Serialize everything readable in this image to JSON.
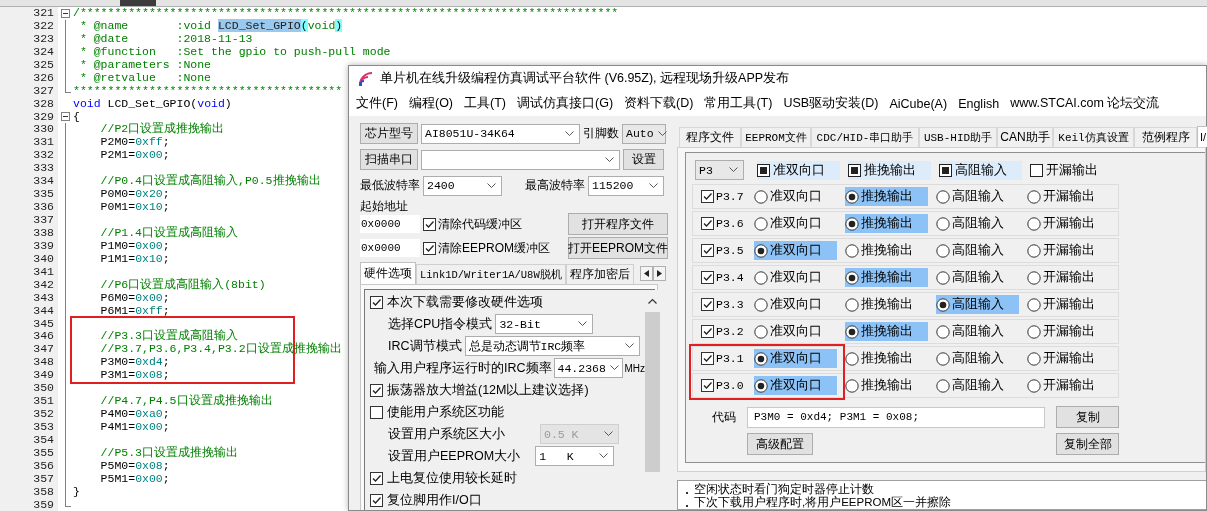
{
  "editor": {
    "lines": [
      {
        "number": "321",
        "fold_toggle": true,
        "tokens": [
          {
            "kind": "comment",
            "text": "/******************************************************************************"
          }
        ]
      },
      {
        "number": "322",
        "fold_line": true,
        "tokens": [
          {
            "kind": "comment",
            "text": " * @name       :void "
          },
          {
            "kind": "selection",
            "text": "LCD_Set_GPIO"
          },
          {
            "kind": "brace",
            "text": "("
          },
          {
            "kind": "comment",
            "text": "void"
          },
          {
            "kind": "brace",
            "text": ")"
          }
        ]
      },
      {
        "number": "323",
        "fold_line": true,
        "tokens": [
          {
            "kind": "comment",
            "text": " * @date       :2018-11-13"
          }
        ]
      },
      {
        "number": "324",
        "fold_line": true,
        "tokens": [
          {
            "kind": "comment",
            "text": " * @function   :Set the gpio to push-pull mode"
          }
        ]
      },
      {
        "number": "325",
        "fold_line": true,
        "tokens": [
          {
            "kind": "comment",
            "text": " * @parameters :None"
          }
        ]
      },
      {
        "number": "326",
        "fold_line": true,
        "tokens": [
          {
            "kind": "comment",
            "text": " * @retvalue   :None"
          }
        ]
      },
      {
        "number": "327",
        "fold_end": true,
        "tokens": [
          {
            "kind": "comment",
            "text": "***************************************"
          }
        ]
      },
      {
        "number": "328",
        "tokens": [
          {
            "kind": "keyword",
            "text": "void"
          },
          {
            "kind": "plain",
            "text": " LCD_Set_GPIO("
          },
          {
            "kind": "keyword",
            "text": "void"
          },
          {
            "kind": "plain",
            "text": ")"
          }
        ]
      },
      {
        "number": "329",
        "fold_toggle": true,
        "tokens": [
          {
            "kind": "plain",
            "text": "{"
          }
        ]
      },
      {
        "number": "330",
        "fold_line": true,
        "tokens": [
          {
            "kind": "comment",
            "text": "    //P2口设置成推挽输出"
          }
        ]
      },
      {
        "number": "331",
        "fold_line": true,
        "tokens": [
          {
            "kind": "plain",
            "text": "    P2M0="
          },
          {
            "kind": "number",
            "text": "0xff"
          },
          {
            "kind": "plain",
            "text": ";"
          }
        ]
      },
      {
        "number": "332",
        "fold_line": true,
        "tokens": [
          {
            "kind": "plain",
            "text": "    P2M1="
          },
          {
            "kind": "number",
            "text": "0x00"
          },
          {
            "kind": "plain",
            "text": ";"
          }
        ]
      },
      {
        "number": "333",
        "fold_line": true
      },
      {
        "number": "334",
        "fold_line": true,
        "tokens": [
          {
            "kind": "comment",
            "text": "    //P0.4口设置成高阻输入,P0.5推挽输出"
          }
        ]
      },
      {
        "number": "335",
        "fold_line": true,
        "tokens": [
          {
            "kind": "plain",
            "text": "    P0M0="
          },
          {
            "kind": "number",
            "text": "0x20"
          },
          {
            "kind": "plain",
            "text": ";"
          }
        ]
      },
      {
        "number": "336",
        "fold_line": true,
        "tokens": [
          {
            "kind": "plain",
            "text": "    P0M1="
          },
          {
            "kind": "number",
            "text": "0x10"
          },
          {
            "kind": "plain",
            "text": ";"
          }
        ]
      },
      {
        "number": "337",
        "fold_line": true
      },
      {
        "number": "338",
        "fold_line": true,
        "tokens": [
          {
            "kind": "comment",
            "text": "    //P1.4口设置成高阻输入"
          }
        ]
      },
      {
        "number": "339",
        "fold_line": true,
        "tokens": [
          {
            "kind": "plain",
            "text": "    P1M0="
          },
          {
            "kind": "number",
            "text": "0x00"
          },
          {
            "kind": "plain",
            "text": ";"
          }
        ]
      },
      {
        "number": "340",
        "fold_line": true,
        "tokens": [
          {
            "kind": "plain",
            "text": "    P1M1="
          },
          {
            "kind": "number",
            "text": "0x10"
          },
          {
            "kind": "plain",
            "text": ";"
          }
        ]
      },
      {
        "number": "341",
        "fold_line": true
      },
      {
        "number": "342",
        "fold_line": true,
        "tokens": [
          {
            "kind": "comment",
            "text": "    //P6口设置成高阻输入(8bit)"
          }
        ]
      },
      {
        "number": "343",
        "fold_line": true,
        "tokens": [
          {
            "kind": "plain",
            "text": "    P6M0="
          },
          {
            "kind": "number",
            "text": "0x00"
          },
          {
            "kind": "plain",
            "text": ";"
          }
        ]
      },
      {
        "number": "344",
        "fold_line": true,
        "tokens": [
          {
            "kind": "plain",
            "text": "    P6M1="
          },
          {
            "kind": "number",
            "text": "0xff"
          },
          {
            "kind": "plain",
            "text": ";"
          }
        ]
      },
      {
        "number": "345",
        "fold_line": true,
        "marked": true
      },
      {
        "number": "346",
        "fold_line": true,
        "marked": true,
        "tokens": [
          {
            "kind": "comment",
            "text": "    //P3.3口设置成高阻输入"
          }
        ]
      },
      {
        "number": "347",
        "fold_line": true,
        "marked": true,
        "tokens": [
          {
            "kind": "comment",
            "text": "    //P3.7,P3.6,P3.4,P3.2口设置成推挽输出"
          }
        ]
      },
      {
        "number": "348",
        "fold_line": true,
        "marked": true,
        "tokens": [
          {
            "kind": "plain",
            "text": "    P3M0="
          },
          {
            "kind": "number",
            "text": "0xd4"
          },
          {
            "kind": "plain",
            "text": ";"
          }
        ]
      },
      {
        "number": "349",
        "fold_line": true,
        "marked": true,
        "tokens": [
          {
            "kind": "plain",
            "text": "    P3M1="
          },
          {
            "kind": "number",
            "text": "0x08"
          },
          {
            "kind": "plain",
            "text": ";"
          }
        ]
      },
      {
        "number": "350",
        "fold_line": true
      },
      {
        "number": "351",
        "fold_line": true,
        "tokens": [
          {
            "kind": "comment",
            "text": "    //P4.7,P4.5口设置成推挽输出"
          }
        ]
      },
      {
        "number": "352",
        "fold_line": true,
        "tokens": [
          {
            "kind": "plain",
            "text": "    P4M0="
          },
          {
            "kind": "number",
            "text": "0xa0"
          },
          {
            "kind": "plain",
            "text": ";"
          }
        ]
      },
      {
        "number": "353",
        "fold_line": true,
        "tokens": [
          {
            "kind": "plain",
            "text": "    P4M1="
          },
          {
            "kind": "number",
            "text": "0x00"
          },
          {
            "kind": "plain",
            "text": ";"
          }
        ]
      },
      {
        "number": "354",
        "fold_line": true
      },
      {
        "number": "355",
        "fold_line": true,
        "tokens": [
          {
            "kind": "comment",
            "text": "    //P5.3口设置成推挽输出"
          }
        ]
      },
      {
        "number": "356",
        "fold_line": true,
        "tokens": [
          {
            "kind": "plain",
            "text": "    P5M0="
          },
          {
            "kind": "number",
            "text": "0x08"
          },
          {
            "kind": "plain",
            "text": ";"
          }
        ]
      },
      {
        "number": "357",
        "fold_line": true,
        "tokens": [
          {
            "kind": "plain",
            "text": "    P5M1="
          },
          {
            "kind": "number",
            "text": "0x00"
          },
          {
            "kind": "plain",
            "text": ";"
          }
        ]
      },
      {
        "number": "358",
        "fold_line": true,
        "tokens": [
          {
            "kind": "plain",
            "text": "}"
          }
        ]
      },
      {
        "number": "359",
        "fold_end": true
      }
    ]
  },
  "window": {
    "title": "单片机在线升级编程仿真调试平台软件 (V6.95Z), 远程现场升级APP发布",
    "menu": [
      "文件(F)",
      "编程(O)",
      "工具(T)",
      "调试仿真接口(G)",
      "资料下载(D)",
      "常用工具(T)",
      "USB驱动安装(D)",
      "AiCube(A)",
      "English",
      "www.STCAI.com 论坛交流"
    ],
    "left": {
      "chip": {
        "button": "芯片型号",
        "value": "AI8051U-34K64",
        "pins_label": "引脚数",
        "pins_value": "Auto"
      },
      "port": {
        "button": "扫描串口",
        "settings_button": "设置"
      },
      "baud": {
        "min_label": "最低波特率",
        "min_value": "2400",
        "max_label": "最高波特率",
        "max_value": "115200"
      },
      "start_address_label": "起始地址",
      "buffers": [
        {
          "address": "0x0000",
          "label": "清除代码缓冲区",
          "checked": true,
          "button": "打开程序文件"
        },
        {
          "address": "0x0000",
          "label": "清除EEPROM缓冲区",
          "checked": true,
          "button": "打开EEPROM文件"
        }
      ],
      "tabs": [
        {
          "label": "硬件选项",
          "selected": true
        },
        {
          "label": "Link1D/Writer1A/U8W脱机",
          "selected": false
        },
        {
          "label": "程序加密后",
          "selected": false
        }
      ],
      "options": [
        {
          "kind": "check",
          "label": "本次下载需要修改硬件选项",
          "checked": true
        },
        {
          "kind": "select",
          "label": "选择CPU指令模式",
          "value": "32-Bit",
          "disabled": false
        },
        {
          "kind": "select",
          "label": "IRC调节模式",
          "value": "总是动态调节IRC频率",
          "disabled": false
        },
        {
          "kind": "combo",
          "label": "输入用户程序运行时的IRC频率",
          "value": "44.2368",
          "unit": "MHz"
        },
        {
          "kind": "check",
          "label": "振荡器放大增益(12M以上建议选择)",
          "checked": true
        },
        {
          "kind": "check",
          "label": "使能用户系统区功能",
          "checked": false
        },
        {
          "kind": "select",
          "label": "设置用户系统区大小",
          "value": "0.5 K",
          "disabled": true
        },
        {
          "kind": "select",
          "label": "设置用户EEPROM大小",
          "value": "1   K",
          "disabled": false
        },
        {
          "kind": "check",
          "label": "上电复位使用较长延时",
          "checked": true
        },
        {
          "kind": "check",
          "label": "复位脚用作I/O口",
          "checked": true
        }
      ]
    },
    "right": {
      "tabs": [
        {
          "label": "程序文件",
          "selected": false
        },
        {
          "label": "EEPROM文件",
          "selected": false
        },
        {
          "label": "CDC/HID-串口助手",
          "selected": false
        },
        {
          "label": "USB-HID助手",
          "selected": false
        },
        {
          "label": "CAN助手",
          "selected": false
        },
        {
          "label": "Keil仿真设置",
          "selected": false
        },
        {
          "label": "范例程序",
          "selected": false
        },
        {
          "label": "I/",
          "selected": true
        }
      ],
      "port_select": "P3",
      "modes": [
        {
          "label": "准双向口",
          "mixed": true
        },
        {
          "label": "推挽输出",
          "mixed": true
        },
        {
          "label": "高阻输入",
          "mixed": true
        },
        {
          "label": "开漏输出",
          "mixed": false
        }
      ],
      "pins": [
        {
          "name": "P3.7",
          "checked": true,
          "marked": false,
          "options": [
            {
              "label": "准双向口",
              "selected": false
            },
            {
              "label": "推挽输出",
              "selected": true
            },
            {
              "label": "高阻输入",
              "selected": false
            },
            {
              "label": "开漏输出",
              "selected": false
            }
          ]
        },
        {
          "name": "P3.6",
          "checked": true,
          "marked": false,
          "options": [
            {
              "label": "准双向口",
              "selected": false
            },
            {
              "label": "推挽输出",
              "selected": true
            },
            {
              "label": "高阻输入",
              "selected": false
            },
            {
              "label": "开漏输出",
              "selected": false
            }
          ]
        },
        {
          "name": "P3.5",
          "checked": true,
          "marked": false,
          "options": [
            {
              "label": "准双向口",
              "selected": true
            },
            {
              "label": "推挽输出",
              "selected": false
            },
            {
              "label": "高阻输入",
              "selected": false
            },
            {
              "label": "开漏输出",
              "selected": false
            }
          ]
        },
        {
          "name": "P3.4",
          "checked": true,
          "marked": false,
          "options": [
            {
              "label": "准双向口",
              "selected": false
            },
            {
              "label": "推挽输出",
              "selected": true
            },
            {
              "label": "高阻输入",
              "selected": false
            },
            {
              "label": "开漏输出",
              "selected": false
            }
          ]
        },
        {
          "name": "P3.3",
          "checked": true,
          "marked": false,
          "options": [
            {
              "label": "准双向口",
              "selected": false
            },
            {
              "label": "推挽输出",
              "selected": false
            },
            {
              "label": "高阻输入",
              "selected": true
            },
            {
              "label": "开漏输出",
              "selected": false
            }
          ]
        },
        {
          "name": "P3.2",
          "checked": true,
          "marked": false,
          "options": [
            {
              "label": "准双向口",
              "selected": false
            },
            {
              "label": "推挽输出",
              "selected": true
            },
            {
              "label": "高阻输入",
              "selected": false
            },
            {
              "label": "开漏输出",
              "selected": false
            }
          ]
        },
        {
          "name": "P3.1",
          "checked": true,
          "marked": true,
          "options": [
            {
              "label": "准双向口",
              "selected": true
            },
            {
              "label": "推挽输出",
              "selected": false
            },
            {
              "label": "高阻输入",
              "selected": false
            },
            {
              "label": "开漏输出",
              "selected": false
            }
          ]
        },
        {
          "name": "P3.0",
          "checked": true,
          "marked": true,
          "options": [
            {
              "label": "准双向口",
              "selected": true
            },
            {
              "label": "推挽输出",
              "selected": false
            },
            {
              "label": "高阻输入",
              "selected": false
            },
            {
              "label": "开漏输出",
              "selected": false
            }
          ]
        }
      ],
      "code_label": "代码",
      "code_value": "P3M0 = 0xd4; P3M1 = 0x08;",
      "copy_button": "复制",
      "advanced_button": "高级配置",
      "copy_all_button": "复制全部",
      "log": [
        "空闲状态时看门狗定时器停止计数",
        "下次下载用户程序时,将用户EEPROM区一并擦除"
      ]
    }
  }
}
